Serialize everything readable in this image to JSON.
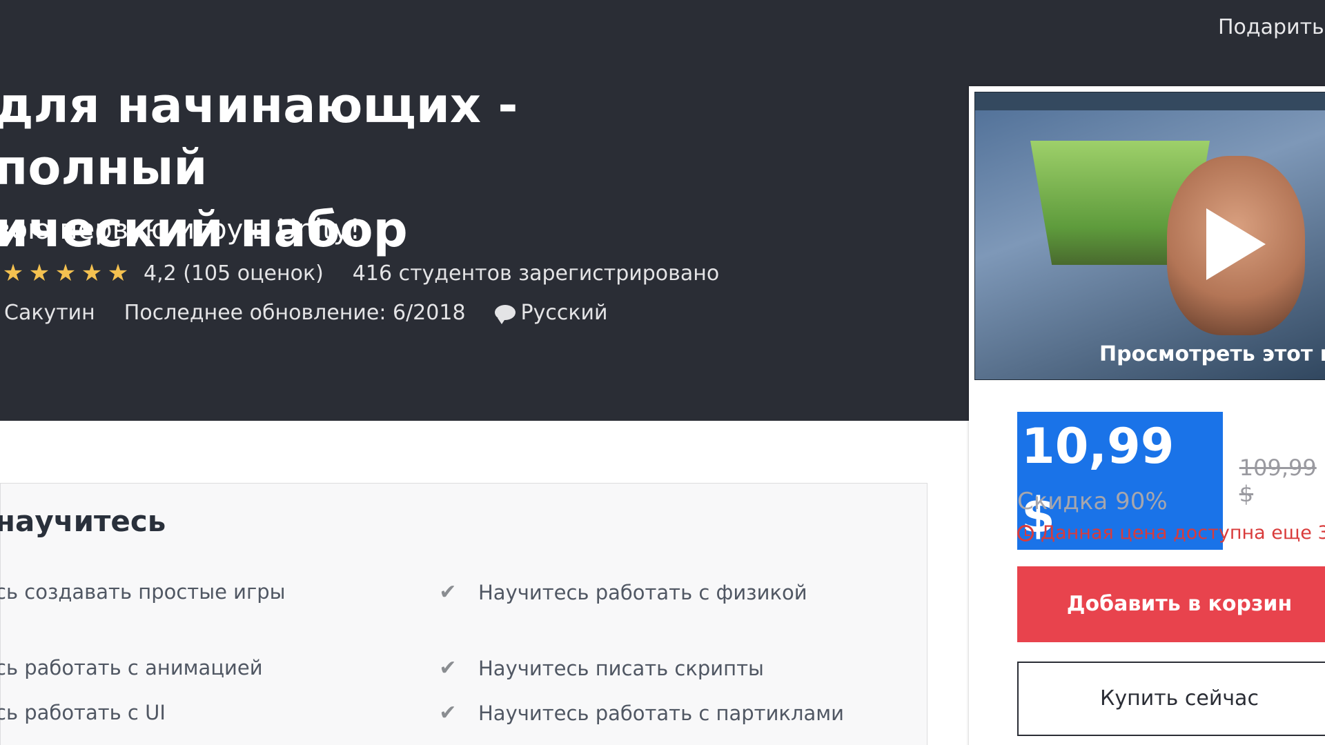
{
  "header": {
    "gift_label": "Подарить"
  },
  "course": {
    "title_line1": "для начинающих - полный",
    "title_line2": "ический набор",
    "subtitle": "вою первую игру в Unity!",
    "rating_text": "4,2 (105 оценок)",
    "students_text": "416 студентов зарегистрировано",
    "author": "Сакутин",
    "last_update": "Последнее обновление: 6/2018",
    "language": "Русский"
  },
  "sidebar": {
    "preview_caption": "Просмотреть этот ку",
    "price": "10,99 $",
    "old_price": "109,99 $",
    "discount": "Скидка 90%",
    "timer_text": "Данная цена доступна еще 3",
    "add_to_cart_label": "Добавить в корзин",
    "buy_now_label": "Купить сейчас"
  },
  "learn": {
    "heading": "научитесь",
    "left_items": [
      "сь создавать простые игры",
      "сь работать с анимацией",
      "сь работать с UI"
    ],
    "right_items": [
      "Научитесь работать с физикой",
      "Научитесь писать скрипты",
      "Научитесь работать с партиклами"
    ]
  },
  "colors": {
    "hero_bg": "#2a2d35",
    "star": "#f4c150",
    "price_highlight": "#1a73e8",
    "cart_button": "#e8434d",
    "timer_red": "#d93b3b"
  },
  "icons": {
    "star": "star-icon",
    "speech": "speech-bubble-icon",
    "play": "play-icon",
    "clock": "clock-icon",
    "check": "check-icon"
  }
}
